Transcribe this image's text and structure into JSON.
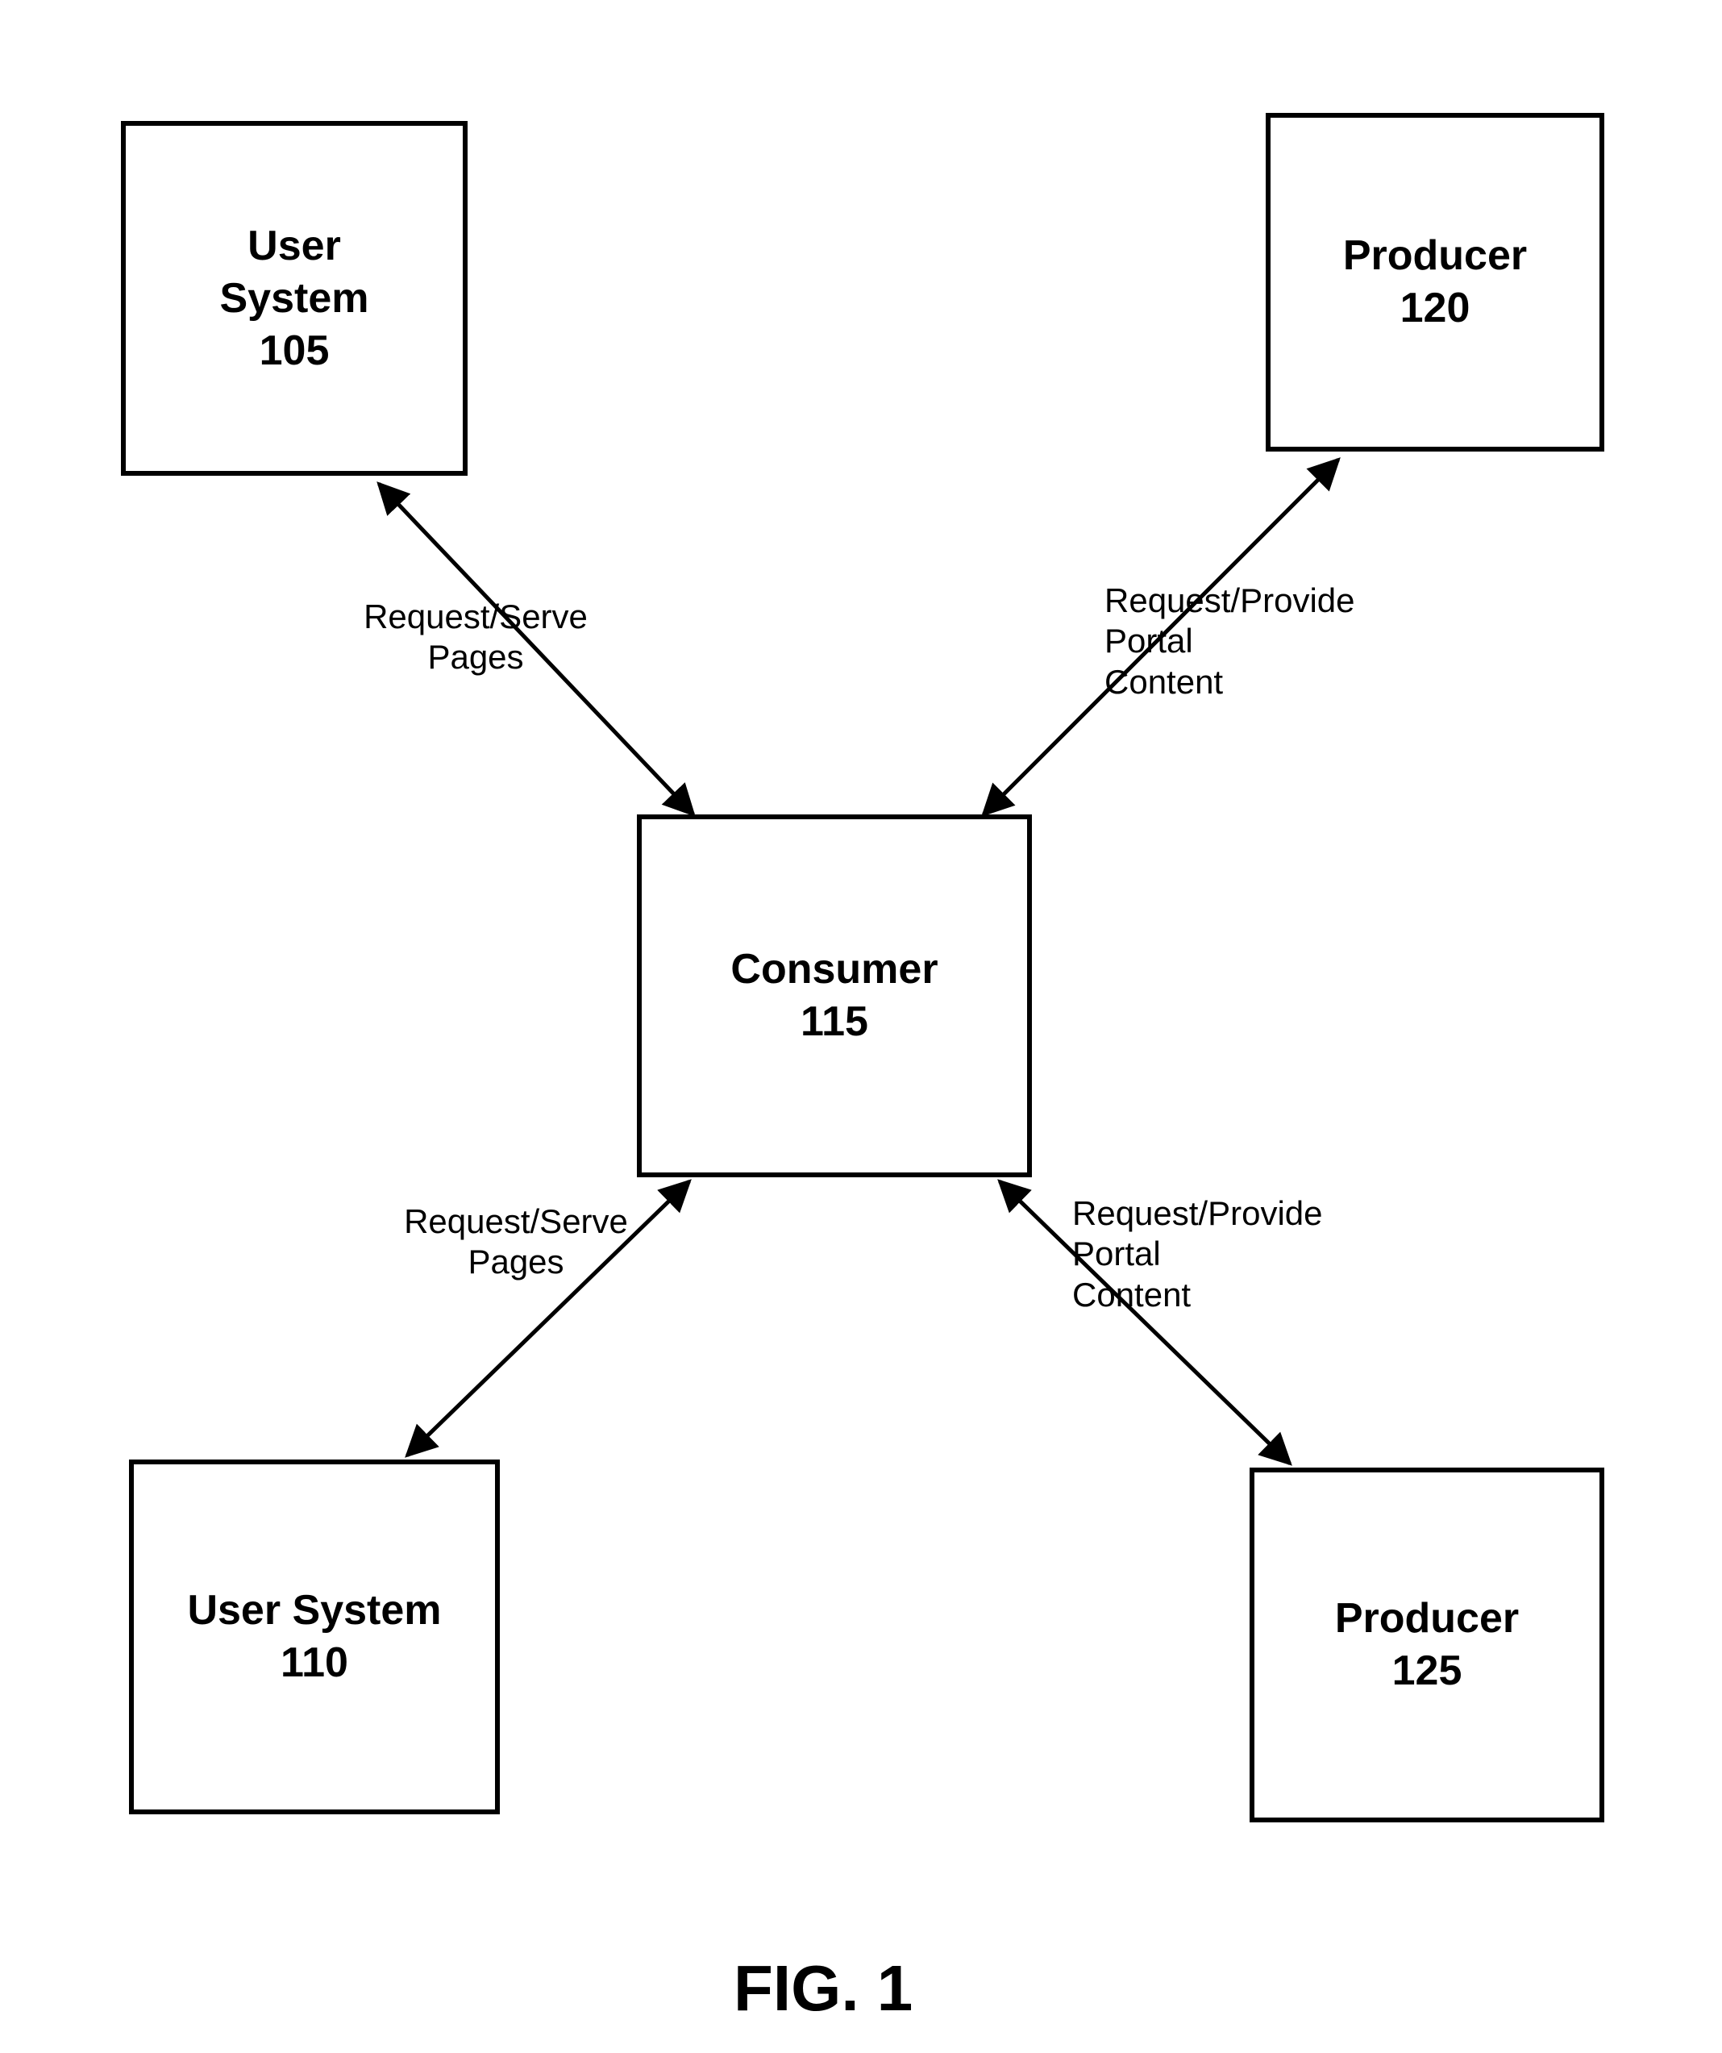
{
  "figure": {
    "caption": "FIG. 1"
  },
  "nodes": {
    "user_system_top": {
      "label": "User\nSystem",
      "num": "105"
    },
    "producer_top": {
      "label": "Producer",
      "num": "120"
    },
    "consumer": {
      "label": "Consumer",
      "num": "115"
    },
    "user_system_bot": {
      "label": "User System",
      "num": "110"
    },
    "producer_bot": {
      "label": "Producer",
      "num": "125"
    }
  },
  "edges": {
    "top_left": {
      "label": "Request/Serve\nPages"
    },
    "top_right": {
      "label": "Request/Provide\nPortal\nContent"
    },
    "bot_left": {
      "label": "Request/Serve\nPages"
    },
    "bot_right": {
      "label": "Request/Provide\nPortal\nContent"
    }
  }
}
